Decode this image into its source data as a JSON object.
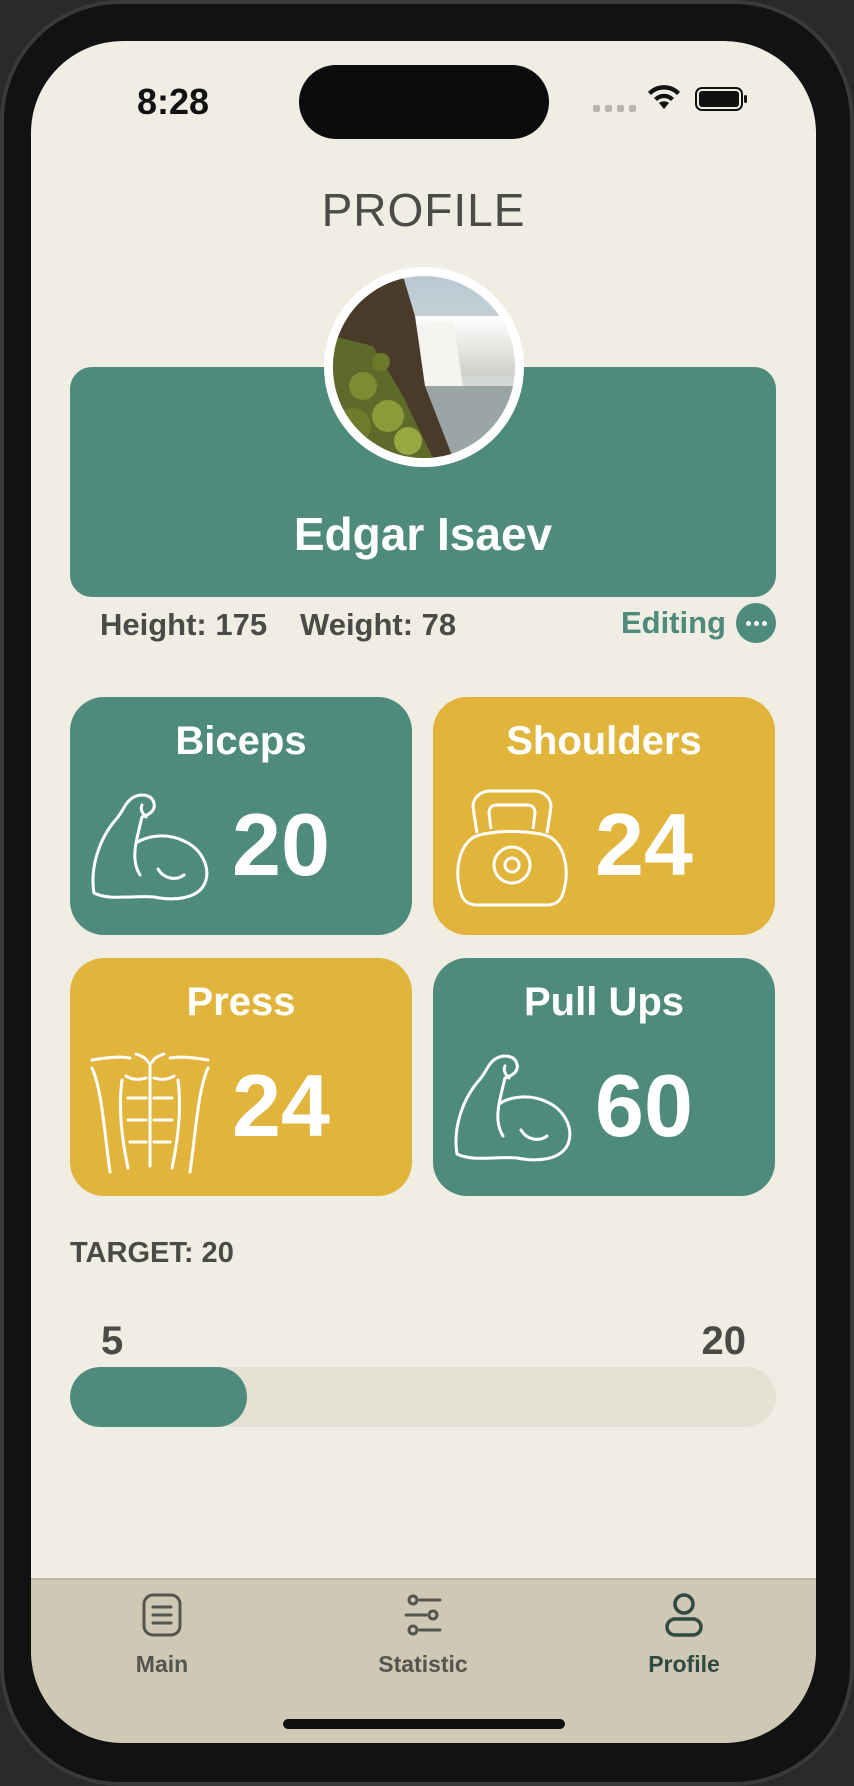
{
  "status_bar": {
    "time": "8:28"
  },
  "header": {
    "title": "PROFILE"
  },
  "profile": {
    "name": "Edgar Isaev",
    "height_label": "Height: 175",
    "weight_label": "Weight: 78",
    "edit_label": "Editing"
  },
  "tiles": [
    {
      "title": "Biceps",
      "value": "20",
      "icon": "flexed-biceps-icon",
      "color": "#4e8b7c"
    },
    {
      "title": "Shoulders",
      "value": "24",
      "icon": "kettlebell-icon",
      "color": "#e1b43c"
    },
    {
      "title": "Press",
      "value": "24",
      "icon": "abs-torso-icon",
      "color": "#e1b43c"
    },
    {
      "title": "Pull Ups",
      "value": "60",
      "icon": "flexed-biceps-icon",
      "color": "#4e8b7c"
    }
  ],
  "target": {
    "label": "TARGET: 20",
    "min": "5",
    "max": "20",
    "progress_fraction": 0.25
  },
  "tabbar": {
    "items": [
      {
        "label": "Main",
        "icon": "list-icon"
      },
      {
        "label": "Statistic",
        "icon": "sliders-icon"
      },
      {
        "label": "Profile",
        "icon": "person-icon"
      }
    ],
    "active": "Profile"
  },
  "colors": {
    "accent_green": "#4e8b7c",
    "accent_yellow": "#e1b43c",
    "background": "#f0ede2",
    "tabbar": "#cfc8b4"
  }
}
